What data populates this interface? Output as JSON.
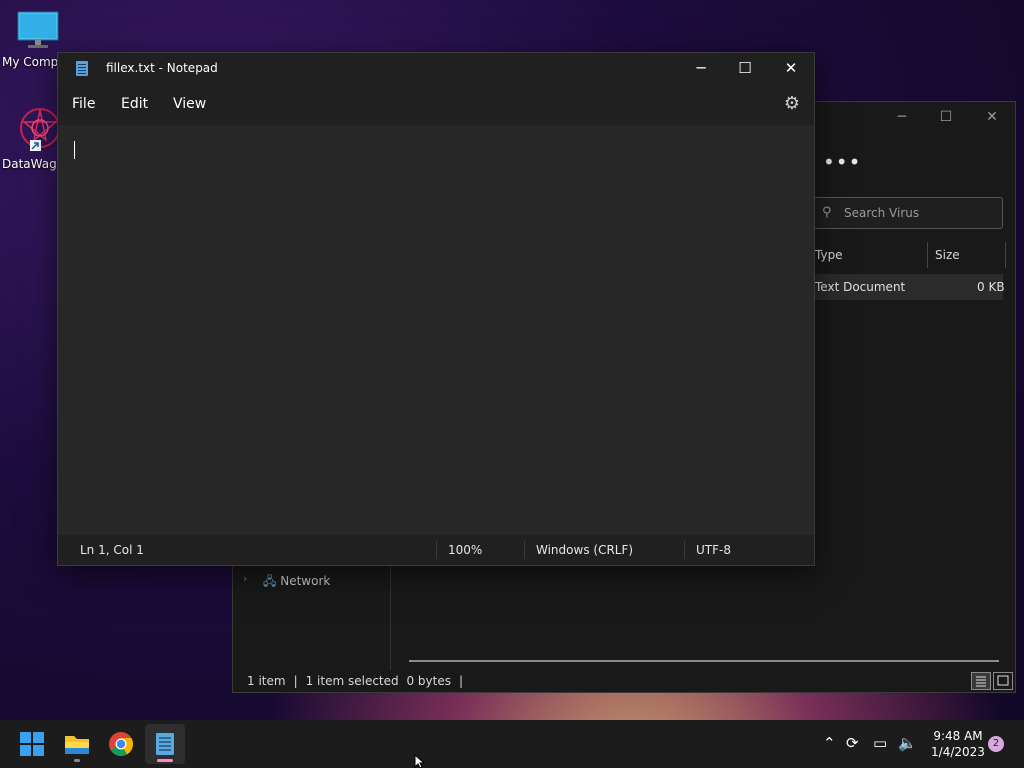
{
  "desktop": {
    "icons": [
      {
        "label": "My Computer",
        "icon": "monitor-icon"
      },
      {
        "label": "DataWagon",
        "icon": "datawagon-shortcut-icon"
      }
    ]
  },
  "explorer": {
    "more_label": "•••",
    "search_placeholder": "Search Virus",
    "columns": [
      "Type",
      "Size"
    ],
    "row": {
      "type": "Text Document",
      "size": "0 KB"
    },
    "nav_item": "Network",
    "status": {
      "items": "1 item",
      "selected": "1 item selected",
      "size": "0 bytes"
    }
  },
  "notepad": {
    "title": "fillex.txt - Notepad",
    "menus": [
      "File",
      "Edit",
      "View"
    ],
    "controls": {
      "minimize": "─",
      "maximize": "☐",
      "close": "✕"
    },
    "content": "",
    "status": {
      "position": "Ln 1, Col 1",
      "zoom": "100%",
      "line_ending": "Windows (CRLF)",
      "encoding": "UTF-8"
    }
  },
  "taskbar": {
    "apps": [
      "start-icon",
      "file-explorer-icon",
      "chrome-icon",
      "notepad-icon"
    ],
    "clock": {
      "time": "9:48 AM",
      "date": "1/4/2023"
    },
    "notification_count": "2"
  },
  "colors": {
    "accent_pink": "#ff88c8",
    "window_dark": "#202020",
    "editor_bg": "#272727"
  }
}
